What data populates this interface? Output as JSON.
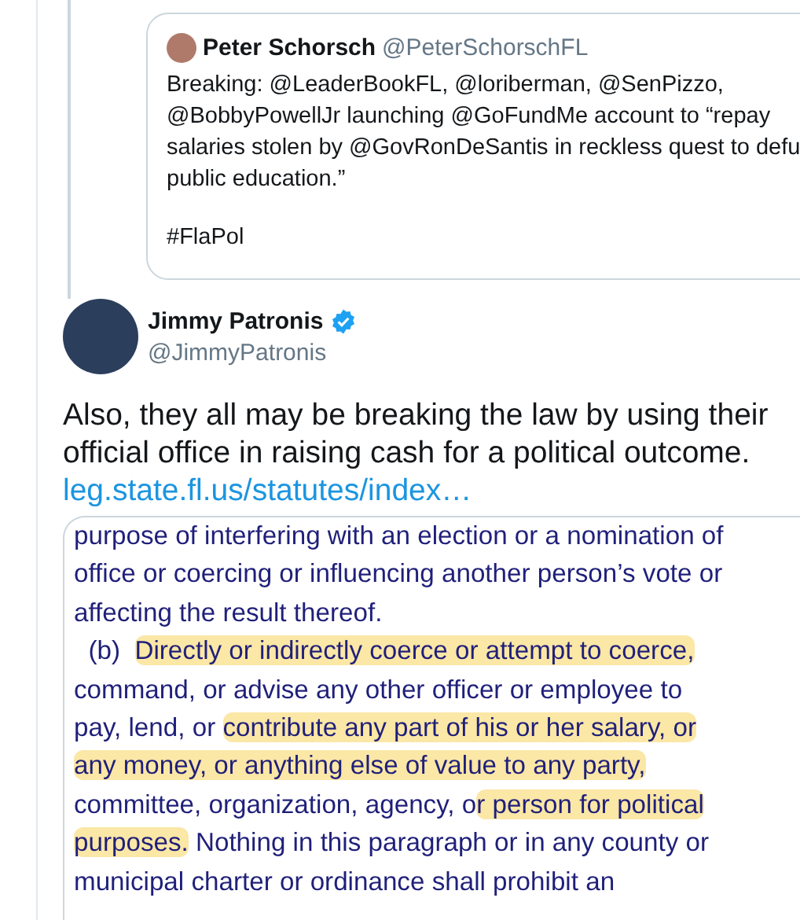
{
  "quoted_tweet": {
    "name": "Peter Schorsch",
    "handle": "@PeterSchorschFL",
    "lines": [
      "Breaking: @LeaderBookFL, @loriberman, @SenPizzo,",
      "@BobbyPowellJr launching @GoFundMe account to “repay",
      "salaries stolen by @GovRonDeSantis in reckless quest to defu",
      "public education.”"
    ],
    "hashtag": "#FlaPol"
  },
  "tweet": {
    "name": "Jimmy Patronis",
    "verified": true,
    "handle": "@JimmyPatronis",
    "text": "Also, they all may be breaking the law by using their official office in raising cash for a political outcome.",
    "link": "leg.state.fl.us/statutes/index…",
    "document_lines": [
      {
        "segments": [
          {
            "text": "purpose of interfering with an election or a nomination of",
            "highlighted": false
          }
        ]
      },
      {
        "segments": [
          {
            "text": "office or coercing or influencing another person’s vote or",
            "highlighted": false
          }
        ]
      },
      {
        "segments": [
          {
            "text": "affecting the result thereof.",
            "highlighted": false
          }
        ]
      },
      {
        "segments": [
          {
            "text": "  (b)  ",
            "highlighted": false
          },
          {
            "text": "Directly or indirectly coerce or attempt to coerce,",
            "highlighted": true
          }
        ]
      },
      {
        "segments": [
          {
            "text": "command, or advise any other officer or employee to",
            "highlighted": false
          }
        ]
      },
      {
        "segments": [
          {
            "text": "pay, lend, or ",
            "highlighted": false
          },
          {
            "text": "contribute any part of his or her salary, or",
            "highlighted": true
          }
        ]
      },
      {
        "segments": [
          {
            "text": "any money, or anything else of value to any party,",
            "highlighted": true
          }
        ]
      },
      {
        "segments": [
          {
            "text": "committee, organization, agency, o",
            "highlighted": false
          },
          {
            "text": "r person for political",
            "highlighted": true
          }
        ]
      },
      {
        "segments": [
          {
            "text": "purposes.",
            "highlighted": true
          },
          {
            "text": " Nothing in this paragraph or in any county or",
            "highlighted": false
          }
        ]
      },
      {
        "segments": [
          {
            "text": "municipal charter or ordinance shall prohibit an",
            "highlighted": false
          }
        ]
      }
    ]
  }
}
